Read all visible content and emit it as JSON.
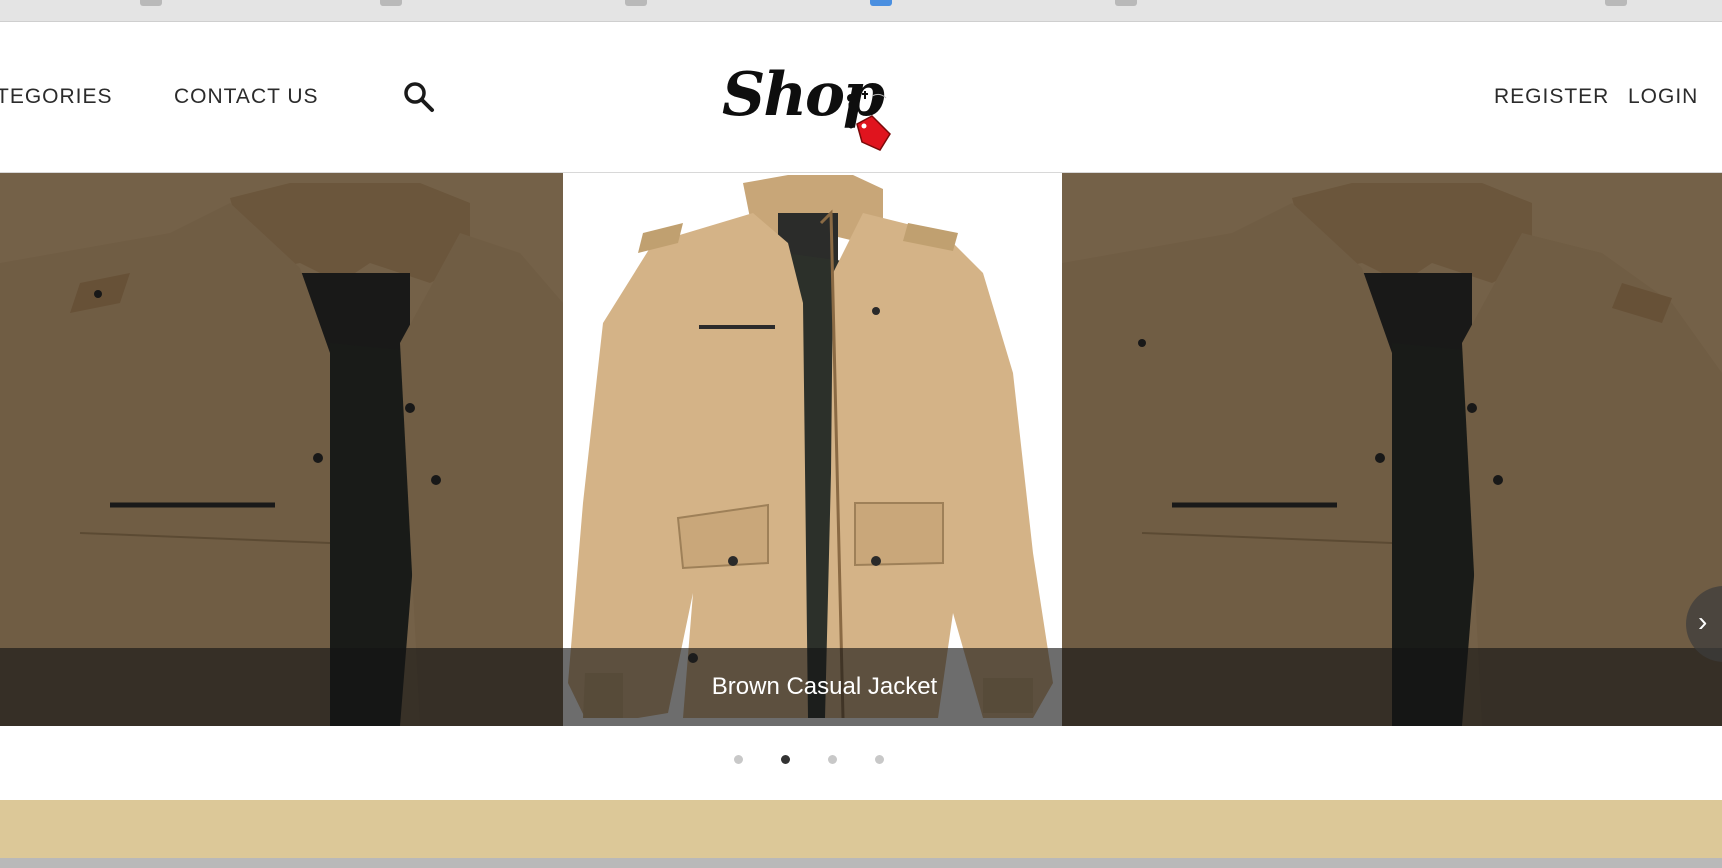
{
  "nav": {
    "categories_label": "TEGORIES",
    "contact_label": "CONTACT US",
    "register_label": "REGISTER",
    "login_label": "LOGIN",
    "search_icon": "search-icon"
  },
  "logo": {
    "text": "Shop",
    "tag_color": "#e0141e"
  },
  "carousel": {
    "caption": "Brown Casual Jacket",
    "slide_count": 4,
    "active_slide": 2,
    "next_icon": "chevron-right-icon"
  },
  "colors": {
    "jacket": "#c9a87c",
    "lining": "#2c302a",
    "band": "#dcc898"
  }
}
